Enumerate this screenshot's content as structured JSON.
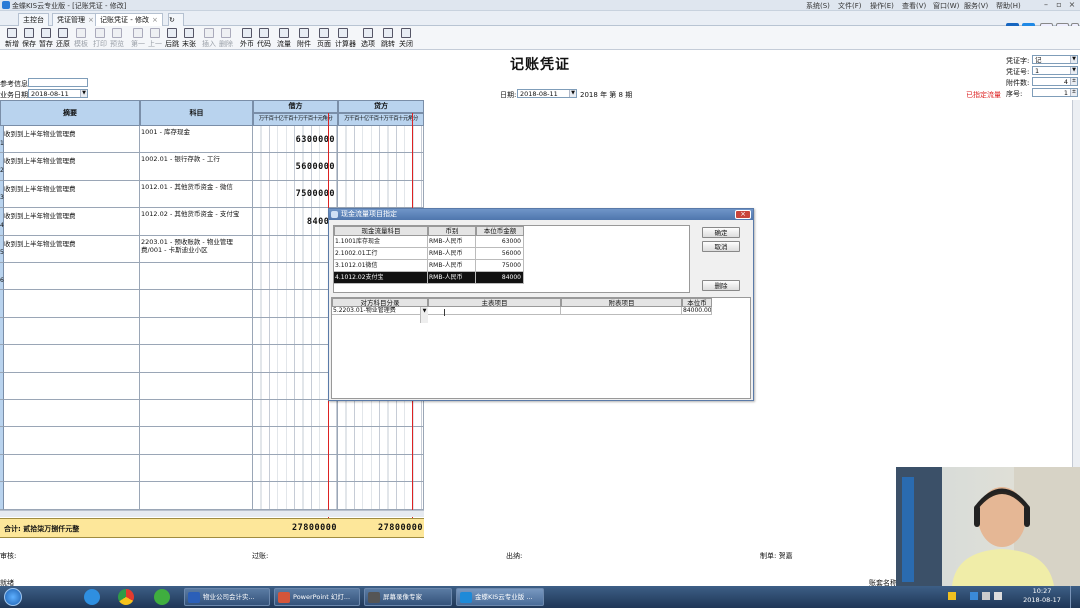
{
  "window": {
    "title": "金蝶KIS云专业版 - [记账凭证 - 修改]",
    "menus": [
      "系统(S)",
      "文件(F)",
      "操作(E)",
      "查看(V)",
      "窗口(W)",
      "服务(V)",
      "帮助(H)"
    ]
  },
  "tabs": [
    {
      "label": "主控台",
      "closable": false,
      "active": false
    },
    {
      "label": "凭证管理",
      "closable": true,
      "active": false
    },
    {
      "label": "记账凭证 - 修改",
      "closable": true,
      "active": true
    }
  ],
  "toolbar": [
    {
      "label": "新增",
      "icon": "new-icon",
      "enabled": true
    },
    {
      "label": "保存",
      "icon": "save-icon",
      "enabled": true
    },
    {
      "label": "暂存",
      "icon": "stash-icon",
      "enabled": true
    },
    {
      "label": "还原",
      "icon": "restore-icon",
      "enabled": true
    },
    {
      "label": "模板",
      "icon": "template-icon",
      "enabled": false
    },
    {
      "label": "打印",
      "icon": "print-icon",
      "enabled": false
    },
    {
      "label": "预览",
      "icon": "preview-icon",
      "enabled": false
    },
    {
      "label": "第一",
      "icon": "first-icon",
      "enabled": false
    },
    {
      "label": "上一",
      "icon": "prev-icon",
      "enabled": false
    },
    {
      "label": "后跳",
      "icon": "next-icon",
      "enabled": true
    },
    {
      "label": "末张",
      "icon": "last-icon",
      "enabled": true
    },
    {
      "label": "插入",
      "icon": "insert-icon",
      "enabled": false
    },
    {
      "label": "删除",
      "icon": "delete-icon",
      "enabled": false
    },
    {
      "label": "外币",
      "icon": "currency-icon",
      "enabled": true
    },
    {
      "label": "代码",
      "icon": "code-icon",
      "enabled": true
    },
    {
      "label": "流量",
      "icon": "flow-icon",
      "enabled": true
    },
    {
      "label": "附件",
      "icon": "attachment-icon",
      "enabled": true
    },
    {
      "label": "页面",
      "icon": "page-icon",
      "enabled": true
    },
    {
      "label": "计算器",
      "icon": "calculator-icon",
      "enabled": true
    },
    {
      "label": "选项",
      "icon": "options-icon",
      "enabled": true
    },
    {
      "label": "跳转",
      "icon": "jump-icon",
      "enabled": true
    },
    {
      "label": "关闭",
      "icon": "close-icon",
      "enabled": true
    }
  ],
  "voucher": {
    "title": "记账凭证",
    "ref_label": "参考信息:",
    "ref_value": "",
    "biz_date_label": "业务日期:",
    "biz_date": "2018-08-11",
    "date_label": "日期:",
    "date": "2018-08-11",
    "year": "2018",
    "year_suffix": "年 第",
    "period": "8",
    "period_suffix": "期",
    "voucher_word_label": "凭证字:",
    "voucher_word": "记",
    "voucher_no_label": "凭证号:",
    "voucher_no": "1",
    "attachments_label": "附件数:",
    "attachments": "4",
    "seq_label": "序号:",
    "seq": "1",
    "flow_status": "已指定流量",
    "col_summary": "摘要",
    "col_account": "科目",
    "col_debit": "借方",
    "col_credit": "贷方",
    "digit_units": "万千百十亿千百十万千百十元角分",
    "rows": [
      {
        "no": "1",
        "summary": "收到到上半年物业管理费",
        "account": "1001 - 库存现金",
        "debit": "6300000",
        "credit": ""
      },
      {
        "no": "2",
        "summary": "收到到上半年物业管理费",
        "account": "1002.01 - 银行存款 - 工行",
        "debit": "5600000",
        "credit": ""
      },
      {
        "no": "3",
        "summary": "收到到上半年物业管理费",
        "account": "1012.01 - 其他货币资金 - 微信",
        "debit": "7500000",
        "credit": ""
      },
      {
        "no": "4",
        "summary": "收到到上半年物业管理费",
        "account": "1012.02 - 其他货币资金 - 支付宝",
        "debit": "84000",
        "credit": ""
      },
      {
        "no": "5",
        "summary": "收到到上半年物业管理费",
        "account": "2203.01 - 预收账款 - 物业管理费/001 - 卡斯迪业小区",
        "debit": "",
        "credit": ""
      },
      {
        "no": "6",
        "summary": "",
        "account": "",
        "debit": "",
        "credit": ""
      }
    ],
    "total_label": "合计: 贰拾柒万捌仟元整",
    "total_debit": "27800000",
    "total_credit": "27800000",
    "audit_label": "审核:",
    "post_label": "过账:",
    "cashier_label": "出纳:",
    "maker_label": "制单:",
    "maker": "贺嘉",
    "status_left": "就绪",
    "status_right": "账套名称"
  },
  "dialog": {
    "title": "现金流量项目指定",
    "top_headers": [
      "现金流量科目",
      "币别",
      "本位币金额"
    ],
    "top_rows": [
      {
        "account": "1.1001库存现金",
        "currency": "RMB-人民币",
        "amount": "63000",
        "selected": false
      },
      {
        "account": "2.1002.01工行",
        "currency": "RMB-人民币",
        "amount": "56000",
        "selected": false
      },
      {
        "account": "3.1012.01微信",
        "currency": "RMB-人民币",
        "amount": "75000",
        "selected": false
      },
      {
        "account": "4.1012.02支付宝",
        "currency": "RMB-人民币",
        "amount": "84000",
        "selected": true
      }
    ],
    "ok_label": "确定",
    "cancel_label": "取消",
    "delete_label": "删除",
    "bottom_headers": [
      "对方科目分录",
      "主表项目",
      "附表项目",
      "本位币"
    ],
    "bottom_rows": [
      {
        "counter": "5.2203.01-物业管理费",
        "main": "",
        "sub": "",
        "amount": "84000.00"
      }
    ]
  },
  "taskbar": {
    "clock_time": "10:27",
    "clock_date": "2018-08-17",
    "items": [
      {
        "label": "物业公司会计实...",
        "color": "#2b5fb8"
      },
      {
        "label": "PowerPoint 幻灯...",
        "color": "#d4553a"
      },
      {
        "label": "屏幕录像专家",
        "color": "#555555"
      },
      {
        "label": "金蝶KIS云专业版 ...",
        "color": "#1e8ad8"
      }
    ]
  },
  "colors": {
    "header_blue": "#b9d3ee",
    "total_yellow": "#fde79a",
    "red_line": "#dd2222",
    "flow_status": "#d22222"
  }
}
